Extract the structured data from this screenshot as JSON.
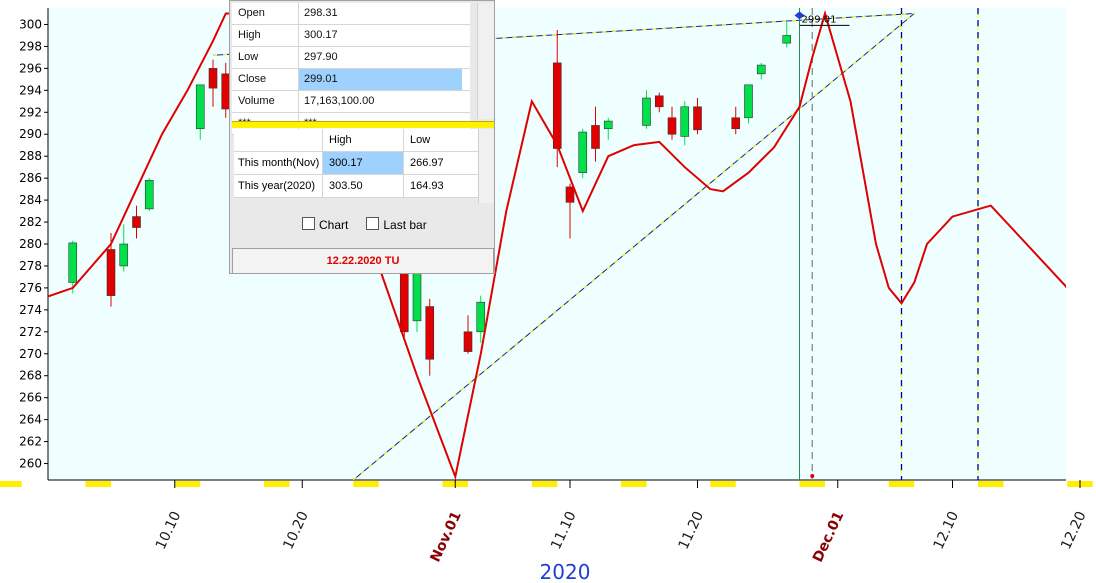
{
  "chart_data": {
    "type": "candlestick",
    "year_label": "2020",
    "yticks": [
      260,
      262,
      264,
      266,
      268,
      270,
      272,
      274,
      276,
      278,
      280,
      282,
      284,
      286,
      288,
      290,
      292,
      294,
      296,
      298,
      300
    ],
    "xticks": [
      {
        "label": "10.10",
        "date": "2020-10-10",
        "major": false
      },
      {
        "label": "10.20",
        "date": "2020-10-20",
        "major": false
      },
      {
        "label": "Nov.01",
        "date": "2020-11-01",
        "major": true
      },
      {
        "label": "11.10",
        "date": "2020-11-10",
        "major": false
      },
      {
        "label": "11.20",
        "date": "2020-11-20",
        "major": false
      },
      {
        "label": "Dec.01",
        "date": "2020-12-01",
        "major": true
      },
      {
        "label": "12.10",
        "date": "2020-12-10",
        "major": false
      },
      {
        "label": "12.20",
        "date": "2020-12-20",
        "major": false
      }
    ],
    "value_label": "299.01",
    "ylim": [
      258.5,
      301.5
    ],
    "candles": [
      {
        "date": "2020-10-02",
        "o": 276.5,
        "h": 280.3,
        "l": 275.5,
        "c": 280.1
      },
      {
        "date": "2020-10-05",
        "o": 279.5,
        "h": 281.0,
        "l": 274.3,
        "c": 275.3
      },
      {
        "date": "2020-10-06",
        "o": 278.0,
        "h": 281.8,
        "l": 277.5,
        "c": 280.0
      },
      {
        "date": "2020-10-07",
        "o": 282.5,
        "h": 283.5,
        "l": 280.5,
        "c": 281.5
      },
      {
        "date": "2020-10-08",
        "o": 283.2,
        "h": 286.0,
        "l": 283.0,
        "c": 285.8
      },
      {
        "date": "2020-10-12",
        "o": 290.5,
        "h": 294.5,
        "l": 289.5,
        "c": 294.5
      },
      {
        "date": "2020-10-13",
        "o": 296.0,
        "h": 296.8,
        "l": 292.5,
        "c": 294.2
      },
      {
        "date": "2020-10-14",
        "o": 295.5,
        "h": 296.5,
        "l": 291.5,
        "c": 292.3
      },
      {
        "date": "2020-10-15",
        "o": 287.5,
        "h": 290.5,
        "l": 286.5,
        "c": 290.2
      },
      {
        "date": "2020-10-16",
        "o": 291.8,
        "h": 292.5,
        "l": 288.0,
        "c": 288.6
      },
      {
        "date": "2020-10-28",
        "o": 279.5,
        "h": 280.5,
        "l": 271.5,
        "c": 272.0
      },
      {
        "date": "2020-10-29",
        "o": 273.0,
        "h": 278.0,
        "l": 272.0,
        "c": 277.5
      },
      {
        "date": "2020-10-30",
        "o": 274.3,
        "h": 275.0,
        "l": 268.0,
        "c": 269.5
      },
      {
        "date": "2020-11-02",
        "o": 272.0,
        "h": 273.5,
        "l": 270.0,
        "c": 270.2
      },
      {
        "date": "2020-11-03",
        "o": 272.0,
        "h": 275.3,
        "l": 271.0,
        "c": 274.7
      },
      {
        "date": "2020-11-09",
        "o": 296.5,
        "h": 299.5,
        "l": 287.0,
        "c": 288.7
      },
      {
        "date": "2020-11-10",
        "o": 285.2,
        "h": 285.5,
        "l": 280.5,
        "c": 283.8
      },
      {
        "date": "2020-11-11",
        "o": 286.5,
        "h": 290.5,
        "l": 286.0,
        "c": 290.2
      },
      {
        "date": "2020-11-12",
        "o": 290.8,
        "h": 292.5,
        "l": 287.5,
        "c": 288.7
      },
      {
        "date": "2020-11-13",
        "o": 290.5,
        "h": 291.5,
        "l": 289.5,
        "c": 291.2
      },
      {
        "date": "2020-11-16",
        "o": 290.8,
        "h": 294.0,
        "l": 290.5,
        "c": 293.3
      },
      {
        "date": "2020-11-17",
        "o": 293.5,
        "h": 293.8,
        "l": 292.0,
        "c": 292.5
      },
      {
        "date": "2020-11-18",
        "o": 291.5,
        "h": 292.5,
        "l": 289.5,
        "c": 290.0
      },
      {
        "date": "2020-11-19",
        "o": 289.8,
        "h": 293.0,
        "l": 289.0,
        "c": 292.5
      },
      {
        "date": "2020-11-20",
        "o": 292.5,
        "h": 293.3,
        "l": 290.0,
        "c": 290.4
      },
      {
        "date": "2020-11-23",
        "o": 291.5,
        "h": 292.5,
        "l": 290.0,
        "c": 290.5
      },
      {
        "date": "2020-11-24",
        "o": 291.5,
        "h": 294.5,
        "l": 291.0,
        "c": 294.5
      },
      {
        "date": "2020-11-25",
        "o": 295.5,
        "h": 296.5,
        "l": 295.0,
        "c": 296.3
      },
      {
        "date": "2020-11-27",
        "o": 298.3,
        "h": 300.2,
        "l": 297.9,
        "c": 299.0
      }
    ],
    "projection_curve": [
      [
        "2020-09-30",
        275.2
      ],
      [
        "2020-10-02",
        276.0
      ],
      [
        "2020-10-05",
        280.0
      ],
      [
        "2020-10-07",
        285.0
      ],
      [
        "2020-10-09",
        290.0
      ],
      [
        "2020-10-11",
        294.0
      ],
      [
        "2020-10-13",
        298.5
      ],
      [
        "2020-10-14",
        301.0
      ],
      [
        "2020-10-15",
        301.0
      ],
      [
        "2020-10-17",
        296.0
      ],
      [
        "2020-10-20",
        288.0
      ],
      [
        "2020-10-23",
        283.0
      ],
      [
        "2020-10-26",
        278.0
      ],
      [
        "2020-10-29",
        268.0
      ],
      [
        "2020-11-01",
        258.8
      ],
      [
        "2020-11-03",
        270.0
      ],
      [
        "2020-11-05",
        283.0
      ],
      [
        "2020-11-07",
        293.0
      ],
      [
        "2020-11-09",
        289.0
      ],
      [
        "2020-11-11",
        283.0
      ],
      [
        "2020-11-13",
        288.0
      ],
      [
        "2020-11-15",
        289.0
      ],
      [
        "2020-11-17",
        289.3
      ],
      [
        "2020-11-19",
        287.0
      ],
      [
        "2020-11-21",
        285.0
      ],
      [
        "2020-11-22",
        284.8
      ],
      [
        "2020-11-24",
        286.5
      ],
      [
        "2020-11-26",
        288.8
      ],
      [
        "2020-11-28",
        292.5
      ],
      [
        "2020-11-29",
        297.0
      ],
      [
        "2020-11-30",
        301.0
      ],
      [
        "2020-12-02",
        293.0
      ],
      [
        "2020-12-04",
        280.0
      ],
      [
        "2020-12-05",
        276.0
      ],
      [
        "2020-12-06",
        274.6
      ],
      [
        "2020-12-07",
        276.5
      ],
      [
        "2020-12-08",
        280.0
      ],
      [
        "2020-12-10",
        282.5
      ],
      [
        "2020-12-13",
        283.5
      ],
      [
        "2020-12-15",
        281.0
      ],
      [
        "2020-12-19",
        276.0
      ],
      [
        "2020-12-22",
        271.0
      ]
    ],
    "trendlines": [
      {
        "from": [
          "2020-10-24",
          258.5
        ],
        "to": [
          "2020-12-07",
          301.0
        ]
      },
      {
        "from": [
          "2020-10-13",
          297.2
        ],
        "to": [
          "2020-12-07",
          301.0
        ]
      }
    ],
    "vlines": [
      {
        "date": "2020-11-28",
        "color": "#2e8b57",
        "style": "solid"
      },
      {
        "date": "2020-11-29",
        "color": "#888888",
        "style": "dashed"
      },
      {
        "date": "2020-12-06",
        "color": "#00008b",
        "style": "dashed"
      },
      {
        "date": "2020-12-12",
        "color": "#00008b",
        "style": "dashed"
      }
    ],
    "colors": {
      "up": "#00e04a",
      "down": "#e00000",
      "curve": "#e00000",
      "bg": "#efffff",
      "trend": "#1a237e",
      "axis_marker": "#ffee00"
    }
  },
  "panel": {
    "ohlcv": [
      {
        "key": "Open",
        "value": "298.31",
        "selected": false
      },
      {
        "key": "High",
        "value": "300.17",
        "selected": false
      },
      {
        "key": "Low",
        "value": "297.90",
        "selected": false
      },
      {
        "key": "Close",
        "value": "299.01",
        "selected": true
      },
      {
        "key": "Volume",
        "value": "17,163,100.00",
        "selected": false
      },
      {
        "key": "***",
        "value": "***",
        "selected": false
      }
    ],
    "range_table": {
      "headers": [
        "",
        "High",
        "Low"
      ],
      "rows": [
        {
          "label": "This month(Nov)",
          "high": "300.17",
          "low": "266.97"
        },
        {
          "label": "This year(2020)",
          "high": "303.50",
          "low": "164.93"
        }
      ]
    },
    "checkbox_chart": "Chart",
    "checkbox_lastbar": "Last bar",
    "date_label": "12.22.2020 TU"
  }
}
